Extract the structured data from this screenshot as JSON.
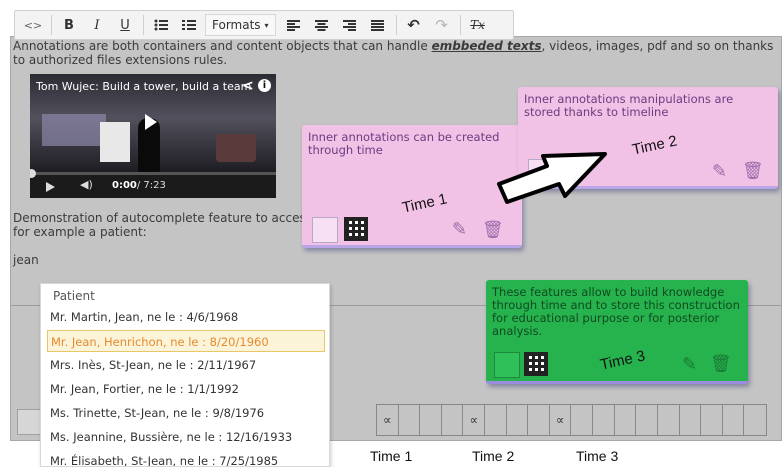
{
  "toolbar": {
    "code_label": "<>",
    "bold_label": "B",
    "italic_label": "I",
    "underline_label": "U",
    "bullet_list_icon": "bullet-list-icon",
    "numbered_list_icon": "numbered-list-icon",
    "formats_label": "Formats",
    "formats_caret": "▾",
    "align_left_glyph": "≡",
    "align_center_glyph": "≡",
    "align_right_glyph": "≡",
    "justify_glyph": "≡",
    "undo_glyph": "↶",
    "redo_glyph": "↷",
    "clear_format_label": "Tx"
  },
  "editor": {
    "intro_prefix": "Annotations are both containers and content objects that can handle ",
    "intro_emphasis": "embbeded texts",
    "intro_suffix": ", videos, images, pdf and so on thanks to authorized files extensions rules.",
    "demo_text": "Demonstration of autocomplete feature to access for example a patient:",
    "typed_text": "jean"
  },
  "video": {
    "title": "Tom Wujec: Build a tower, build a team",
    "share_glyph": "<",
    "info_glyph": "i",
    "volume_glyph": "◀)",
    "current_time": "0:00",
    "duration": "/ 7:23"
  },
  "notes": [
    {
      "text": "Inner annotations can be created through time",
      "time_label": "Time 1",
      "edit_glyph": "✎",
      "delete_glyph": "🗑"
    },
    {
      "text": "Inner annotations manipulations are stored thanks to timeline",
      "time_label": "Time 2",
      "edit_glyph": "✎",
      "delete_glyph": "🗑"
    },
    {
      "text": "These features allow to build knowledge through time and to store this construction for educational purpose or for posterior analysis.",
      "time_label": "Time 3",
      "edit_glyph": "✎",
      "delete_glyph": "🗑"
    }
  ],
  "autocomplete": {
    "header": "Patient",
    "items": [
      "Mr. Martin, Jean, ne le : 4/6/1968",
      "Mr. Jean, Henrichon, ne le : 8/20/1960",
      "Mrs. Inès, St-Jean, ne le : 2/11/1967",
      "Mr. Jean, Fortier, ne le : 1/1/1992",
      "Ms. Trinette, St-Jean, ne le : 9/8/1976",
      "Ms. Jeannine, Bussière, ne le : 12/16/1933",
      "Mr. Élisabeth, St-Jean, ne le : 7/25/1985"
    ],
    "active_index": 1
  },
  "timeline": {
    "marker_glyph": "∝",
    "labels": [
      "Time 1",
      "Time 2",
      "Time 3"
    ]
  },
  "colors": {
    "note_pink": "#f2c2e6",
    "note_green": "#26b34e",
    "editor_bg": "#c4c4c4",
    "active_item_text": "#e88a2c"
  }
}
